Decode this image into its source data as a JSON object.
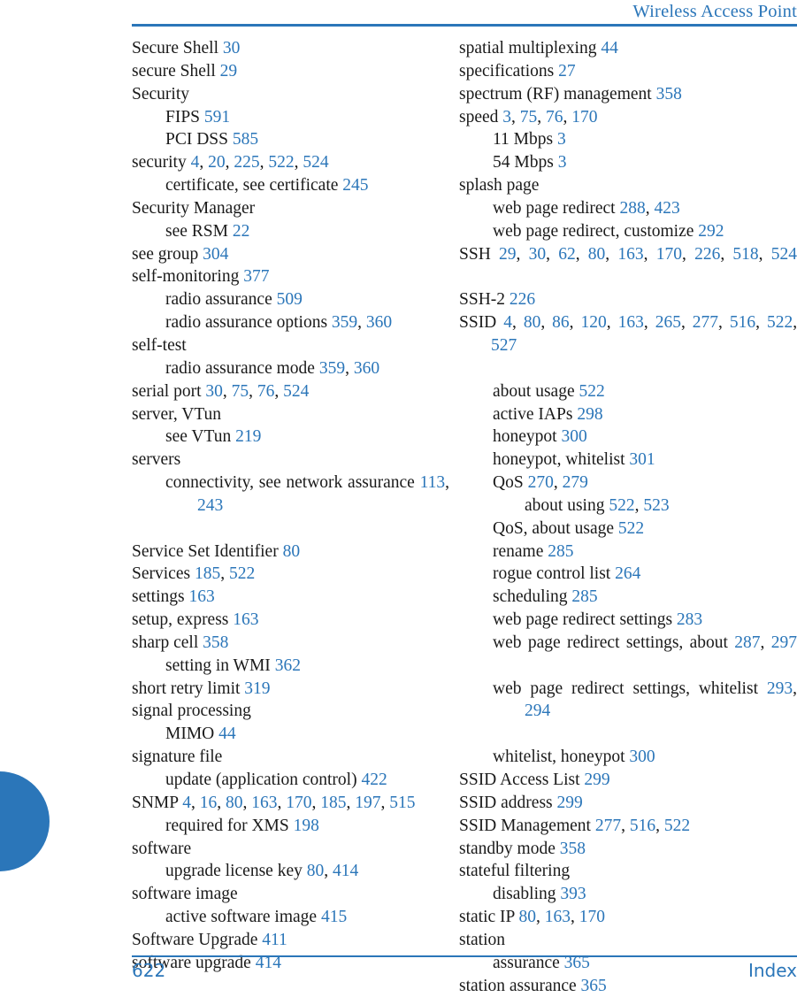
{
  "colors": {
    "accent": "#2b76b9",
    "text": "#1a1a1a",
    "page": "#ffffff"
  },
  "header": {
    "title": "Wireless Access Point"
  },
  "footer": {
    "page_number": "622",
    "section_label": "Index"
  },
  "columns": {
    "left": [
      {
        "level": 0,
        "text": "Secure Shell ",
        "pages": "30"
      },
      {
        "level": 0,
        "text": "secure Shell ",
        "pages": "29"
      },
      {
        "level": 0,
        "text": "Security",
        "pages": ""
      },
      {
        "level": 1,
        "text": "FIPS ",
        "pages": "591"
      },
      {
        "level": 1,
        "text": "PCI DSS ",
        "pages": "585"
      },
      {
        "level": 0,
        "text": "security ",
        "pages": "4, 20, 225, 522, 524"
      },
      {
        "level": 1,
        "text": "certificate, see certificate ",
        "pages": "245"
      },
      {
        "level": 0,
        "text": "Security Manager",
        "pages": ""
      },
      {
        "level": 1,
        "text": "see RSM ",
        "pages": "22"
      },
      {
        "level": 0,
        "text": "see group ",
        "pages": "304"
      },
      {
        "level": 0,
        "text": "self-monitoring ",
        "pages": "377"
      },
      {
        "level": 1,
        "text": "radio assurance ",
        "pages": "509"
      },
      {
        "level": 1,
        "text": "radio assurance options ",
        "pages": "359, 360"
      },
      {
        "level": 0,
        "text": "self-test",
        "pages": ""
      },
      {
        "level": 1,
        "text": "radio assurance mode ",
        "pages": "359, 360"
      },
      {
        "level": 0,
        "text": "serial port ",
        "pages": "30, 75, 76, 524"
      },
      {
        "level": 0,
        "text": "server, VTun",
        "pages": ""
      },
      {
        "level": 1,
        "text": "see VTun ",
        "pages": "219"
      },
      {
        "level": 0,
        "text": "servers",
        "pages": ""
      },
      {
        "level": 1,
        "text": "connectivity, see network assurance ",
        "pages": "113, 243",
        "justify": true
      },
      {
        "level": 0,
        "text": "Service Set Identifier ",
        "pages": "80"
      },
      {
        "level": 0,
        "text": "Services ",
        "pages": "185, 522"
      },
      {
        "level": 0,
        "text": "settings ",
        "pages": "163"
      },
      {
        "level": 0,
        "text": "setup, express ",
        "pages": "163"
      },
      {
        "level": 0,
        "text": "sharp cell ",
        "pages": "358"
      },
      {
        "level": 1,
        "text": "setting in WMI ",
        "pages": "362"
      },
      {
        "level": 0,
        "text": "short retry limit ",
        "pages": "319"
      },
      {
        "level": 0,
        "text": "signal processing",
        "pages": ""
      },
      {
        "level": 1,
        "text": "MIMO ",
        "pages": "44"
      },
      {
        "level": 0,
        "text": "signature file",
        "pages": ""
      },
      {
        "level": 1,
        "text": "update (application control) ",
        "pages": "422"
      },
      {
        "level": 0,
        "text": "SNMP ",
        "pages": "4, 16, 80, 163, 170, 185, 197, 515"
      },
      {
        "level": 1,
        "text": "required for XMS ",
        "pages": "198"
      },
      {
        "level": 0,
        "text": "software",
        "pages": ""
      },
      {
        "level": 1,
        "text": "upgrade license key ",
        "pages": "80, 414"
      },
      {
        "level": 0,
        "text": "software image",
        "pages": ""
      },
      {
        "level": 1,
        "text": "active software image ",
        "pages": "415"
      },
      {
        "level": 0,
        "text": "Software Upgrade ",
        "pages": "411"
      },
      {
        "level": 0,
        "text": "software upgrade ",
        "pages": "414"
      }
    ],
    "right": [
      {
        "level": 0,
        "text": "spatial multiplexing ",
        "pages": "44"
      },
      {
        "level": 0,
        "text": "specifications ",
        "pages": "27"
      },
      {
        "level": 0,
        "text": "spectrum (RF) management ",
        "pages": "358"
      },
      {
        "level": 0,
        "text": "speed ",
        "pages": "3, 75, 76, 170"
      },
      {
        "level": 1,
        "text": "11 Mbps ",
        "pages": "3"
      },
      {
        "level": 1,
        "text": "54 Mbps ",
        "pages": "3"
      },
      {
        "level": 0,
        "text": "splash page",
        "pages": ""
      },
      {
        "level": 1,
        "text": "web page redirect ",
        "pages": "288, 423"
      },
      {
        "level": 1,
        "text": "web page redirect, customize ",
        "pages": "292"
      },
      {
        "level": 0,
        "text": "SSH ",
        "pages": "29, 30, 62, 80, 163, 170, 226, 518, 524",
        "justify": true
      },
      {
        "level": 0,
        "text": "SSH-2 ",
        "pages": "226"
      },
      {
        "level": 0,
        "text": "SSID ",
        "pages": "4, 80, 86, 120, 163, 265, 277, 516, 522, 527",
        "justify": true
      },
      {
        "level": 1,
        "text": "about usage ",
        "pages": "522"
      },
      {
        "level": 1,
        "text": "active IAPs ",
        "pages": "298"
      },
      {
        "level": 1,
        "text": "honeypot ",
        "pages": "300"
      },
      {
        "level": 1,
        "text": "honeypot, whitelist ",
        "pages": "301"
      },
      {
        "level": 1,
        "text": "QoS ",
        "pages": "270, 279"
      },
      {
        "level": 2,
        "text": "about using ",
        "pages": "522, 523"
      },
      {
        "level": 1,
        "text": "QoS, about usage ",
        "pages": "522"
      },
      {
        "level": 1,
        "text": "rename ",
        "pages": "285"
      },
      {
        "level": 1,
        "text": "rogue control list ",
        "pages": "264"
      },
      {
        "level": 1,
        "text": "scheduling ",
        "pages": "285"
      },
      {
        "level": 1,
        "text": "web page redirect settings ",
        "pages": "283"
      },
      {
        "level": 1,
        "text": "web page redirect settings, about ",
        "pages": "287, 297",
        "justify": true
      },
      {
        "level": 1,
        "text": "web page redirect settings, whitelist ",
        "pages": "293, 294",
        "justify": true
      },
      {
        "level": 1,
        "text": "whitelist, honeypot ",
        "pages": "300"
      },
      {
        "level": 0,
        "text": "SSID Access List ",
        "pages": "299"
      },
      {
        "level": 0,
        "text": "SSID address ",
        "pages": "299"
      },
      {
        "level": 0,
        "text": "SSID Management ",
        "pages": "277, 516, 522"
      },
      {
        "level": 0,
        "text": "standby mode ",
        "pages": "358"
      },
      {
        "level": 0,
        "text": "stateful filtering",
        "pages": ""
      },
      {
        "level": 1,
        "text": "disabling ",
        "pages": "393"
      },
      {
        "level": 0,
        "text": "static IP ",
        "pages": "80, 163, 170"
      },
      {
        "level": 0,
        "text": "station",
        "pages": ""
      },
      {
        "level": 1,
        "text": "assurance ",
        "pages": "365"
      },
      {
        "level": 0,
        "text": "station assurance ",
        "pages": "365"
      }
    ]
  }
}
